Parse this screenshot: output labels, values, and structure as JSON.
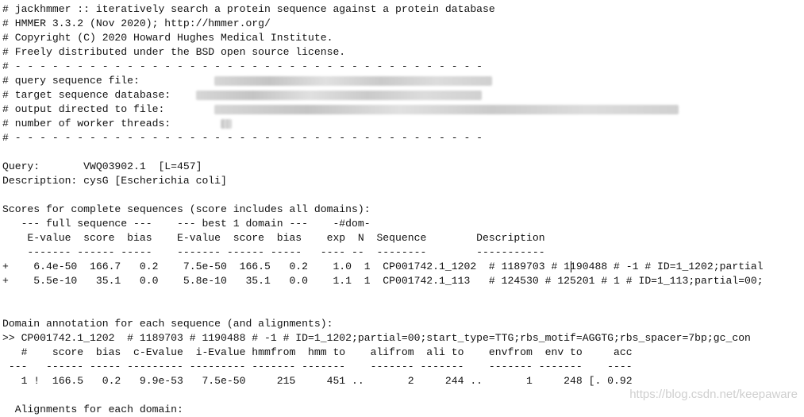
{
  "header_lines": [
    "# jackhmmer :: iteratively search a protein sequence against a protein database",
    "# HMMER 3.3.2 (Nov 2020); http://hmmer.org/",
    "# Copyright (C) 2020 Howard Hughes Medical Institute.",
    "# Freely distributed under the BSD open source license.",
    "# - - - - - - - - - - - - - - - - - - - - - - - - - - - - - - - - - - - - - -"
  ],
  "params": [
    {
      "label": "# query sequence file:            "
    },
    {
      "label": "# target sequence database:    "
    },
    {
      "label": "# output directed to file:        "
    },
    {
      "label": "# number of worker threads:        "
    }
  ],
  "separator": "# - - - - - - - - - - - - - - - - - - - - - - - - - - - - - - - - - - - - - -",
  "query": "Query:       VWQ03902.1  [L=457]",
  "description": "Description: cysG [Escherichia coli]",
  "scores_title": "Scores for complete sequences (score includes all domains):",
  "scores_table": [
    "   --- full sequence ---    --- best 1 domain ---    -#dom-",
    "    E-value  score  bias    E-value  score  bias    exp  N  Sequence        Description",
    "    ------- ------ -----    ------- ------ -----   ---- --  --------        -----------",
    "+    6.4e-50  166.7   0.2    7.5e-50  166.5   0.2    1.0  1  CP001742.1_1202  # 1189703 # 1190488 # -1 # ID=1_1202;partial",
    "+    5.5e-10   35.1   0.0    5.8e-10   35.1   0.0    1.1  1  CP001742.1_113   # 124530 # 125201 # 1 # ID=1_113;partial=00;"
  ],
  "domain_title": "Domain annotation for each sequence (and alignments):",
  "domain_lines": [
    ">> CP001742.1_1202  # 1189703 # 1190488 # -1 # ID=1_1202;partial=00;start_type=TTG;rbs_motif=AGGTG;rbs_spacer=7bp;gc_con",
    "   #    score  bias  c-Evalue  i-Evalue hmmfrom  hmm to    alifrom  ali to    envfrom  env to     acc",
    " ---   ------ ----- --------- --------- ------- -------    ------- -------    ------- -------    ----",
    "   1 !  166.5   0.2   9.9e-53   7.5e-50     215     451 ..       2     244 ..       1     248 [. 0.92"
  ],
  "alignments_title": "  Alignments for each domain:",
  "watermark": "https://blog.csdn.net/keepaware"
}
